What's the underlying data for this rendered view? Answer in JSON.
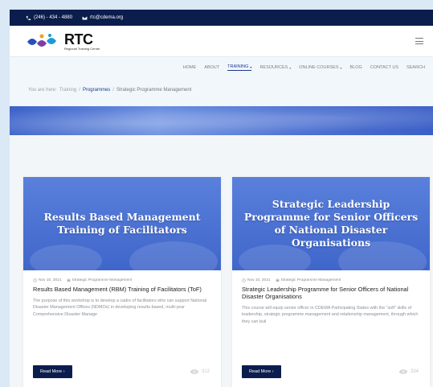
{
  "topbar": {
    "phone": "(246) - 434 - 4880",
    "email": "rtc@cdema.org"
  },
  "header": {
    "logo_text": "RTC",
    "logo_sub": "Regional Training Centre"
  },
  "nav": {
    "items": [
      {
        "label": "HOME",
        "dropdown": false
      },
      {
        "label": "ABOUT",
        "dropdown": false
      },
      {
        "label": "TRAINING",
        "dropdown": true,
        "active": true
      },
      {
        "label": "RESOURCES",
        "dropdown": true
      },
      {
        "label": "ONLINE COURSES",
        "dropdown": true
      },
      {
        "label": "BLOG",
        "dropdown": false
      },
      {
        "label": "CONTACT US",
        "dropdown": false
      },
      {
        "label": "SEARCH",
        "dropdown": false
      }
    ]
  },
  "breadcrumb": {
    "prefix": "You are here:",
    "training": "Training",
    "sep1": "/",
    "programmes": "Programmes",
    "sep2": "/",
    "current": "Strategic Programme Management"
  },
  "cards": [
    {
      "image_title": "Results Based Management Training of Facilitators",
      "date": "Nov 10, 2021",
      "category": "Strategic Programme Management",
      "title": "Results Based Management (RBM) Training of Facilitators (ToF)",
      "excerpt": "The purpose of this workshop is to develop a cadre of facilitators who can support National Disaster Management Offices (NDMOs) in developing results-based, multi-year Comprehensive Disaster Manage",
      "button": "Read More ›",
      "views": "312"
    },
    {
      "image_title": "Strategic Leadership Programme for Senior Officers of National Disaster Organisations",
      "date": "Nov 10, 2021",
      "category": "Strategic Programme Management",
      "title": "Strategic Leadership Programme for Senior Officers of National Disaster Organisations",
      "excerpt": "This course will equip senior officer in CDEMA Participating States with the “soft” skills of leadership, strategic programme management and relationship management, through which they can buil",
      "button": "Read More ›",
      "views": "334"
    }
  ],
  "colors": {
    "navy": "#0b1d4d",
    "accent": "#1c3a8a",
    "hero_blue": "#4f73d4"
  }
}
